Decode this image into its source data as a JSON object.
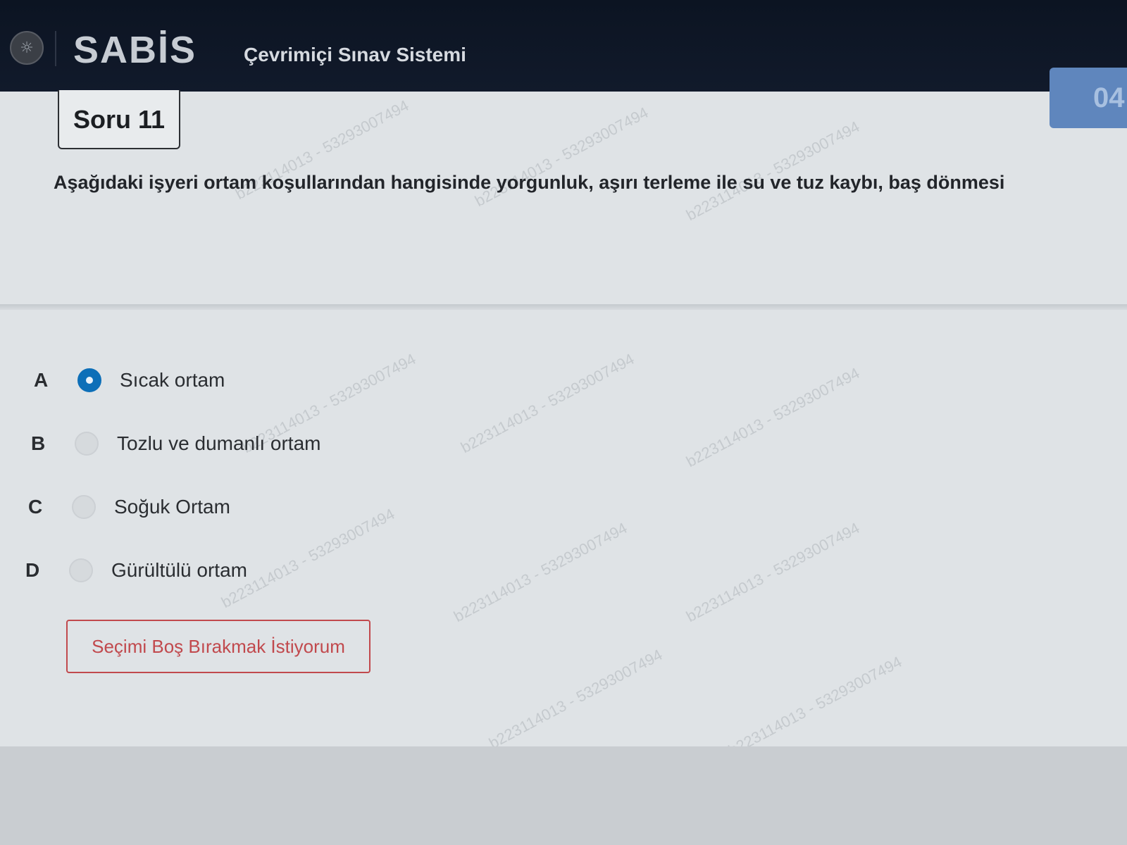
{
  "header": {
    "brand": "SABİS",
    "app_title": "Çevrimiçi Sınav Sistemi",
    "timer": "04"
  },
  "question": {
    "label": "Soru 11",
    "text": "Aşağıdaki işyeri ortam koşullarından hangisinde yorgunluk, aşırı terleme ile su ve tuz kaybı, baş dönmesi"
  },
  "options": [
    {
      "letter": "A",
      "text": "Sıcak ortam",
      "selected": true
    },
    {
      "letter": "B",
      "text": "Tozlu ve dumanlı ortam",
      "selected": false
    },
    {
      "letter": "C",
      "text": "Soğuk Ortam",
      "selected": false
    },
    {
      "letter": "D",
      "text": "Gürültülü ortam",
      "selected": false
    }
  ],
  "blank_button_label": "Seçimi Boş Bırakmak İstiyorum",
  "watermark_text": "b223114013 - 53293007494"
}
